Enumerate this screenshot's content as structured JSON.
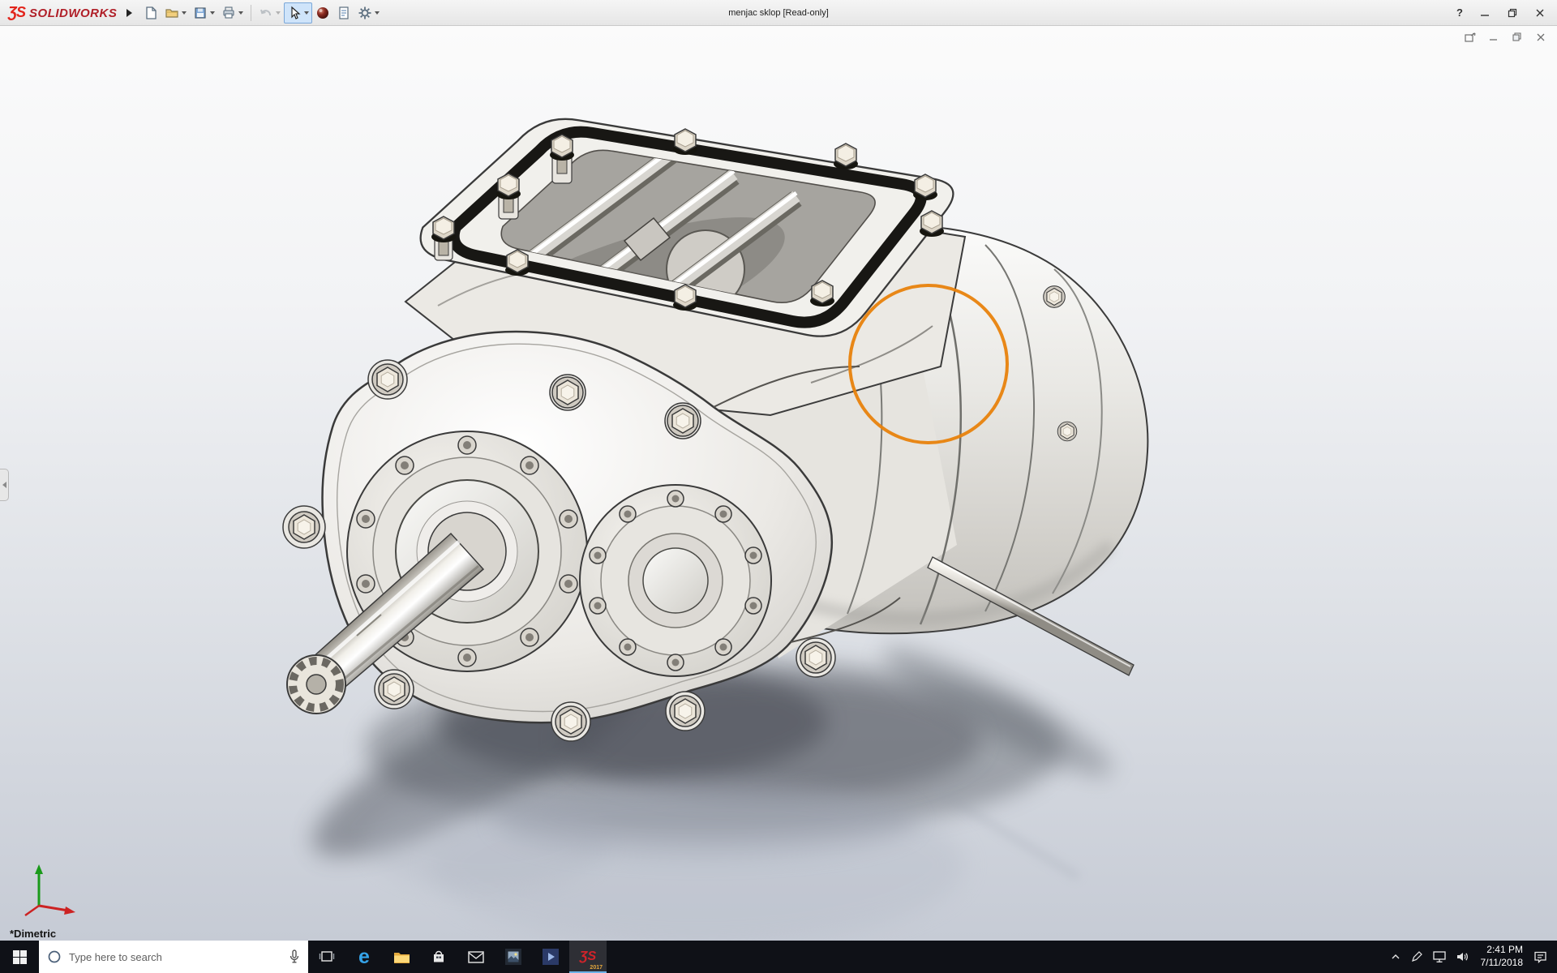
{
  "titlebar": {
    "brand_glyph": "ƷS",
    "brand_name": "SOLIDWORKS",
    "document_title": "menjac sklop [Read-only]",
    "help_label": "?"
  },
  "toolbar": {
    "icons": [
      "new-document",
      "open",
      "save",
      "print",
      "undo",
      "select-cursor",
      "material-sphere",
      "document-properties",
      "options-gear"
    ]
  },
  "viewport": {
    "view_orientation_label": "*Dimetric",
    "annotation_circle_color": "#E8820C",
    "triad_colors": {
      "x": "#CC2222",
      "y": "#1A9A1A"
    }
  },
  "colors": {
    "solidworks_red": "#D1232A",
    "annotation_orange": "#E8820C",
    "taskbar_dark": "#0F1117"
  },
  "taskbar": {
    "search_placeholder": "Type here to search",
    "edge_glyph": "e",
    "solidworks_glyph": "ƷS",
    "solidworks_badge": "2017",
    "apps": [
      "task-view",
      "edge",
      "file-explorer",
      "store",
      "mail",
      "photos",
      "movies",
      "solidworks"
    ],
    "clock": {
      "time": "2:41 PM",
      "date": "7/11/2018"
    }
  }
}
